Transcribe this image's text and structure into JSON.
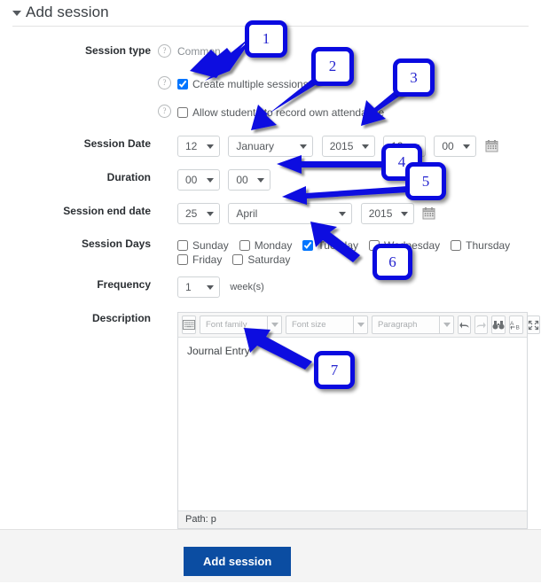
{
  "header": {
    "title": "Add session",
    "collapse_icon": "caret-down-icon"
  },
  "form": {
    "session_type": {
      "label": "Session type",
      "help_icon": "help-icon",
      "value": "Common"
    },
    "create_multiple": {
      "help_icon": "help-icon",
      "label": "Create multiple sessions",
      "checked": true
    },
    "allow_students": {
      "help_icon": "help-icon",
      "label": "Allow students to record own attendance",
      "checked": false
    },
    "session_date": {
      "label": "Session Date",
      "day": "12",
      "month": "January",
      "year": "2015",
      "hour": "12",
      "minute": "00",
      "calendar_icon": "calendar-icon"
    },
    "duration": {
      "label": "Duration",
      "hours": "00",
      "minutes": "00"
    },
    "session_end_date": {
      "label": "Session end date",
      "day": "25",
      "month": "April",
      "year": "2015",
      "calendar_icon": "calendar-icon"
    },
    "session_days": {
      "label": "Session Days",
      "days": [
        {
          "label": "Sunday",
          "checked": false
        },
        {
          "label": "Monday",
          "checked": false
        },
        {
          "label": "Tuesday",
          "checked": true
        },
        {
          "label": "Wednesday",
          "checked": false
        },
        {
          "label": "Thursday",
          "checked": false
        },
        {
          "label": "Friday",
          "checked": false
        },
        {
          "label": "Saturday",
          "checked": false
        }
      ]
    },
    "frequency": {
      "label": "Frequency",
      "value": "1",
      "units": "week(s)"
    },
    "description": {
      "label": "Description",
      "toolbar": {
        "keyboard_icon": "keyboard-icon",
        "font_family": "Font family",
        "font_size": "Font size",
        "paragraph": "Paragraph",
        "undo_icon": "undo-icon",
        "redo_icon": "redo-icon",
        "find_icon": "find-icon",
        "replace_icon": "find-replace-icon",
        "fullscreen_icon": "fullscreen-icon"
      },
      "content": "Journal Entry",
      "path": "Path: p"
    }
  },
  "footer": {
    "submit_label": "Add session"
  },
  "annotations": [
    {
      "number": "1"
    },
    {
      "number": "2"
    },
    {
      "number": "3"
    },
    {
      "number": "4"
    },
    {
      "number": "5"
    },
    {
      "number": "6"
    },
    {
      "number": "7"
    }
  ],
  "colors": {
    "annotation_blue": "#0a0ae0",
    "annotation_text": "#2424cf",
    "submit_blue": "#0b4da2"
  }
}
